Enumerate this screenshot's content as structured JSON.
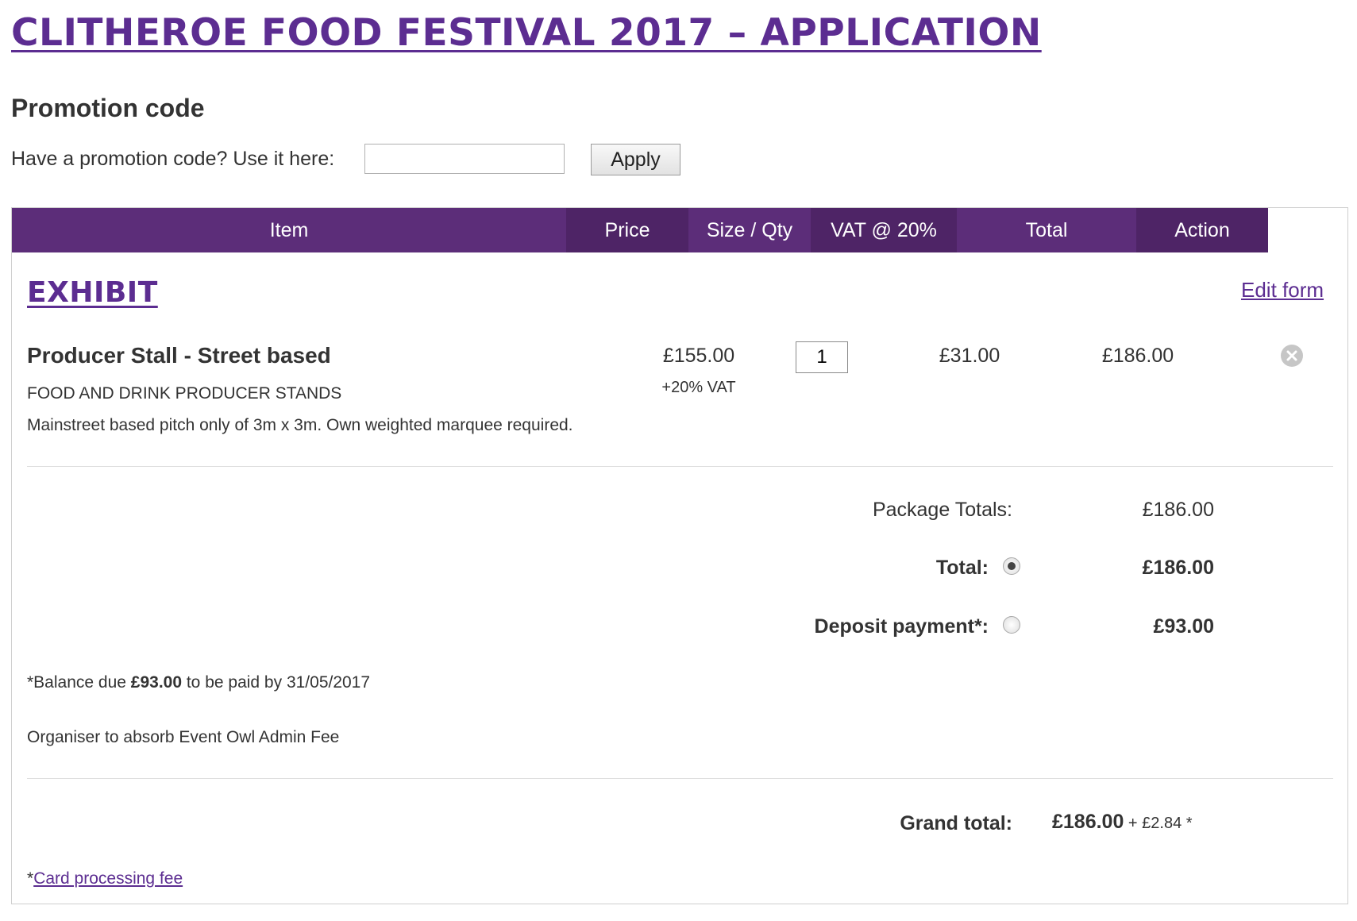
{
  "page": {
    "title": "CLITHEROE FOOD FESTIVAL 2017 – APPLICATION"
  },
  "promo": {
    "heading": "Promotion code",
    "label": "Have a promotion code? Use it here:",
    "input_value": "",
    "apply_label": "Apply"
  },
  "table": {
    "headers": {
      "item": "Item",
      "price": "Price",
      "qty": "Size / Qty",
      "vat": "VAT @ 20%",
      "total": "Total",
      "action": "Action"
    }
  },
  "section": {
    "title": "EXHIBIT",
    "edit_label": "Edit form"
  },
  "item": {
    "name": "Producer Stall - Street based",
    "category": "FOOD AND DRINK PRODUCER STANDS",
    "description": "Mainstreet based pitch only of 3m x 3m. Own weighted marquee required.",
    "price": "£155.00",
    "price_note": "+20% VAT",
    "qty": "1",
    "vat": "£31.00",
    "total": "£186.00",
    "remove_icon": "close-circle-icon"
  },
  "summary": {
    "package_label": "Package Totals:",
    "package_value": "£186.00",
    "total_label": "Total:",
    "total_value": "£186.00",
    "total_selected": true,
    "deposit_label": "Deposit payment*:",
    "deposit_value": "£93.00",
    "deposit_selected": false
  },
  "notes": {
    "balance_prefix": "*Balance due ",
    "balance_amount": "£93.00",
    "balance_suffix": " to be paid by 31/05/2017",
    "admin_fee": "Organiser to absorb Event Owl Admin Fee"
  },
  "grand": {
    "label": "Grand total:",
    "value": "£186.00",
    "fee": " + £2.84 *"
  },
  "footer": {
    "asterisk": "*",
    "fee_link": "Card processing fee"
  },
  "colors": {
    "brand_purple": "#5c2d91",
    "header_light": "#5c2d79",
    "header_dark": "#4e2466"
  }
}
